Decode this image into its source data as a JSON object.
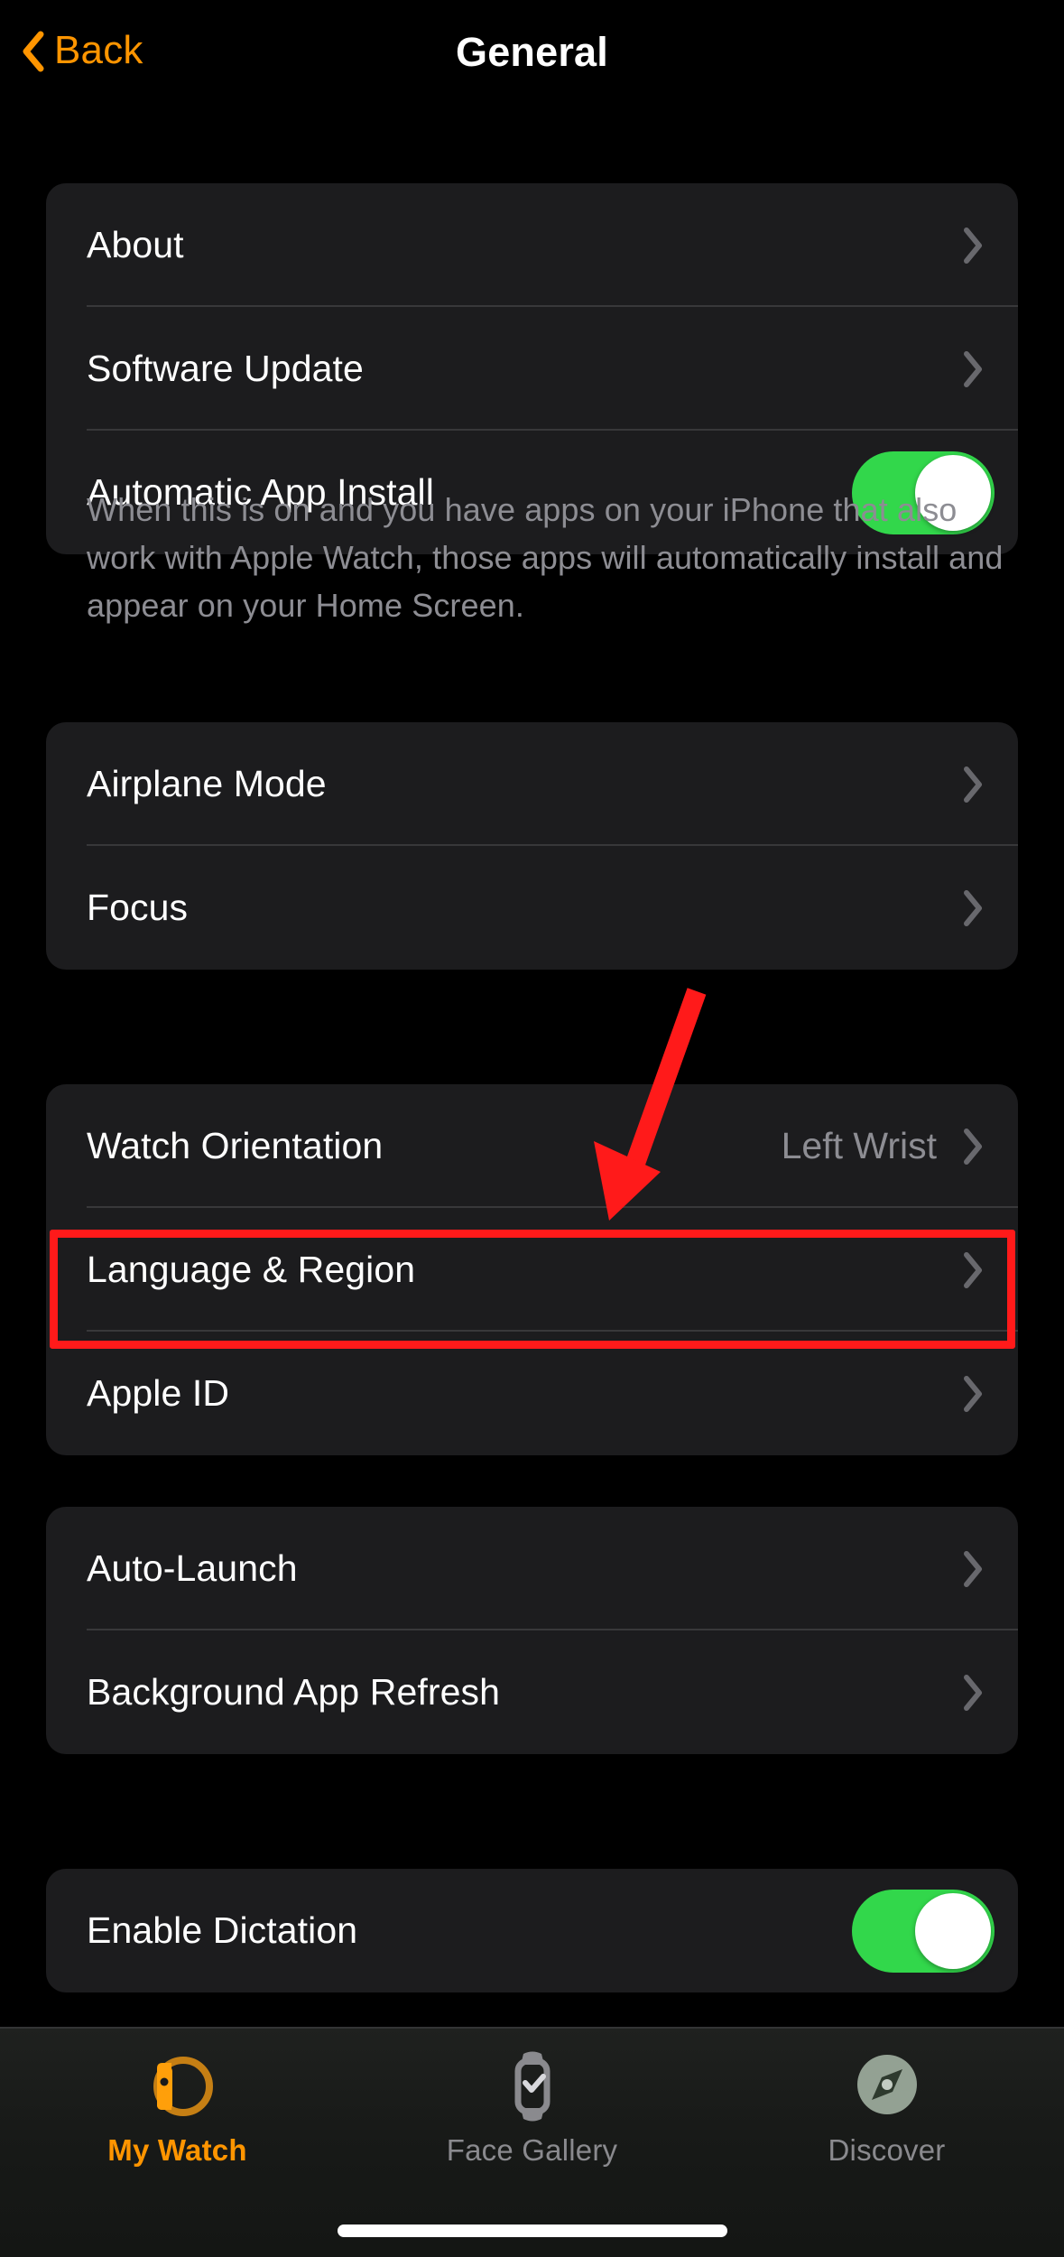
{
  "nav": {
    "back_label": "Back",
    "title": "General",
    "back_icon": "chevron-left-icon",
    "accent_color": "#FF9500"
  },
  "groups": [
    {
      "id": "group-system",
      "rows": [
        {
          "label": "About",
          "type": "disclosure",
          "chevron": "chevron-right-icon"
        },
        {
          "label": "Software Update",
          "type": "disclosure",
          "chevron": "chevron-right-icon"
        },
        {
          "label": "Automatic App Install",
          "type": "toggle",
          "toggle_on": true,
          "toggle_color": "#32D74B"
        }
      ],
      "footer": "When this is on and you have apps on your iPhone that also work with Apple Watch, those apps will automatically install and appear on your Home Screen."
    },
    {
      "id": "group-connectivity",
      "rows": [
        {
          "label": "Airplane Mode",
          "type": "disclosure",
          "chevron": "chevron-right-icon"
        },
        {
          "label": "Focus",
          "type": "disclosure",
          "chevron": "chevron-right-icon"
        }
      ]
    },
    {
      "id": "group-device",
      "rows": [
        {
          "label": "Watch Orientation",
          "type": "value",
          "value": "Left Wrist",
          "chevron": "chevron-right-icon"
        },
        {
          "label": "Language & Region",
          "type": "disclosure",
          "chevron": "chevron-right-icon",
          "highlighted": true
        },
        {
          "label": "Apple ID",
          "type": "disclosure",
          "chevron": "chevron-right-icon"
        }
      ]
    },
    {
      "id": "group-apps",
      "rows": [
        {
          "label": "Auto-Launch",
          "type": "disclosure",
          "chevron": "chevron-right-icon"
        },
        {
          "label": "Background App Refresh",
          "type": "disclosure",
          "chevron": "chevron-right-icon"
        }
      ]
    },
    {
      "id": "group-dictation",
      "rows": [
        {
          "label": "Enable Dictation",
          "type": "toggle",
          "toggle_on": true,
          "toggle_color": "#32D74B"
        }
      ]
    }
  ],
  "annotation": {
    "highlight_color": "#FF1A1A",
    "arrow_target": "Language & Region",
    "arrow_icon": "arrow-down-left-icon"
  },
  "tabbar": {
    "items": [
      {
        "label": "My Watch",
        "icon": "watch-side-icon",
        "active": true
      },
      {
        "label": "Face Gallery",
        "icon": "watch-check-icon",
        "active": false
      },
      {
        "label": "Discover",
        "icon": "compass-icon",
        "active": false
      }
    ]
  }
}
